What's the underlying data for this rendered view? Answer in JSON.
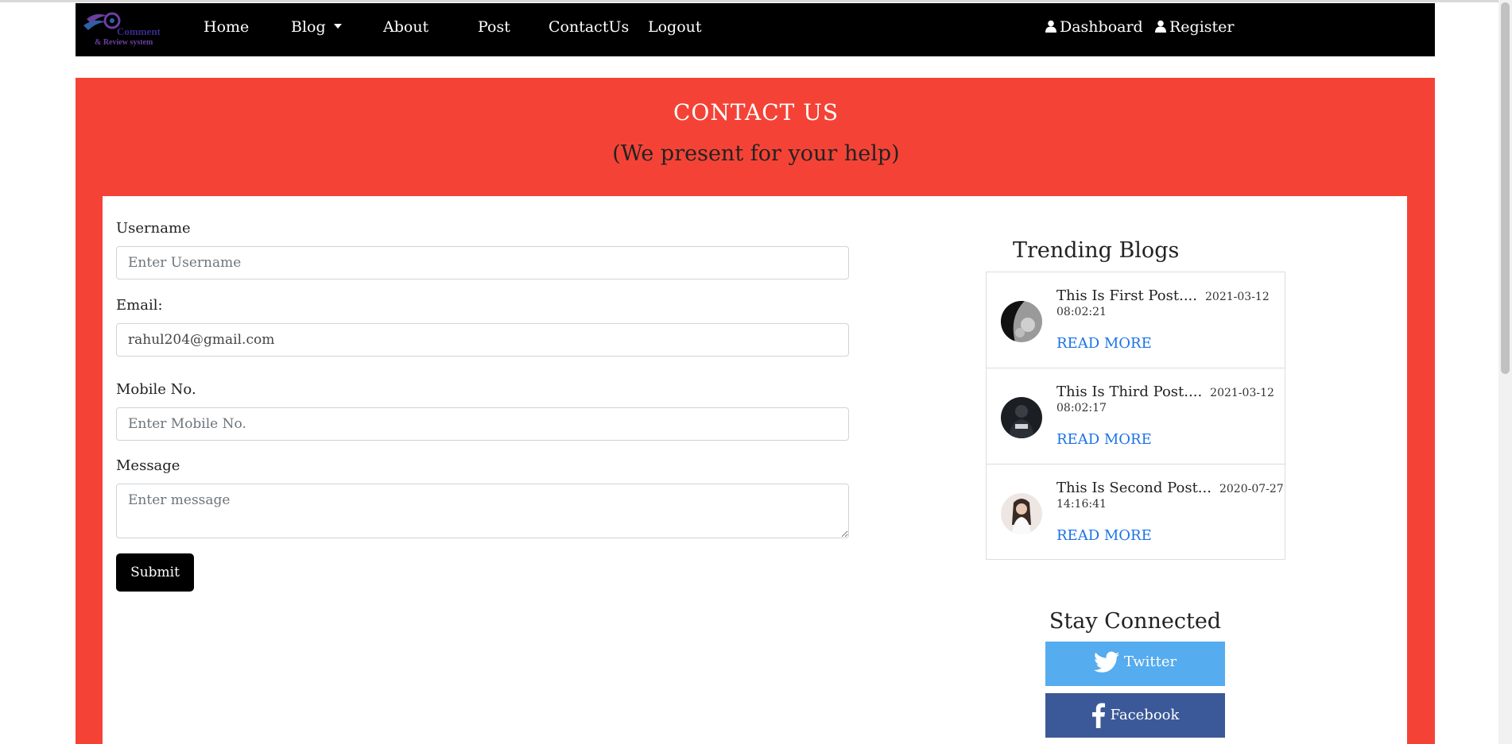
{
  "colors": {
    "navbar": "#000000",
    "hero": "#f44336",
    "link": "#1a73e8",
    "twitter": "#55acee",
    "facebook": "#3b5998"
  },
  "navbar": {
    "logo": {
      "line1": "Comment",
      "line2": "& Review system"
    },
    "links": [
      "Home",
      "Blog",
      "About",
      "Post",
      "ContactUs",
      "Logout"
    ],
    "right_links": [
      "Dashboard",
      "Register"
    ]
  },
  "hero": {
    "title": "CONTACT  US",
    "subtitle": "(We present for your help)"
  },
  "form": {
    "username_label": "Username",
    "username_placeholder": "Enter Username",
    "email_label": "Email:",
    "email_value": "rahul204@gmail.com",
    "mobile_label": "Mobile No.",
    "mobile_placeholder": "Enter Mobile No.",
    "message_label": "Message",
    "message_placeholder": "Enter message",
    "submit_label": "Submit"
  },
  "trending": {
    "title": "Trending Blogs",
    "posts": [
      {
        "title": "This Is First Post....",
        "date": "2021-03-12",
        "time": "08:02:21",
        "link": "READ MORE"
      },
      {
        "title": "This Is Third Post....",
        "date": "2021-03-12",
        "time": "08:02:17",
        "link": "READ MORE"
      },
      {
        "title": "This Is Second Post...",
        "date": "2020-07-27",
        "time": "14:16:41",
        "link": "READ MORE"
      }
    ]
  },
  "social": {
    "title": "Stay Connected",
    "twitter": "Twitter",
    "facebook": "Facebook"
  }
}
